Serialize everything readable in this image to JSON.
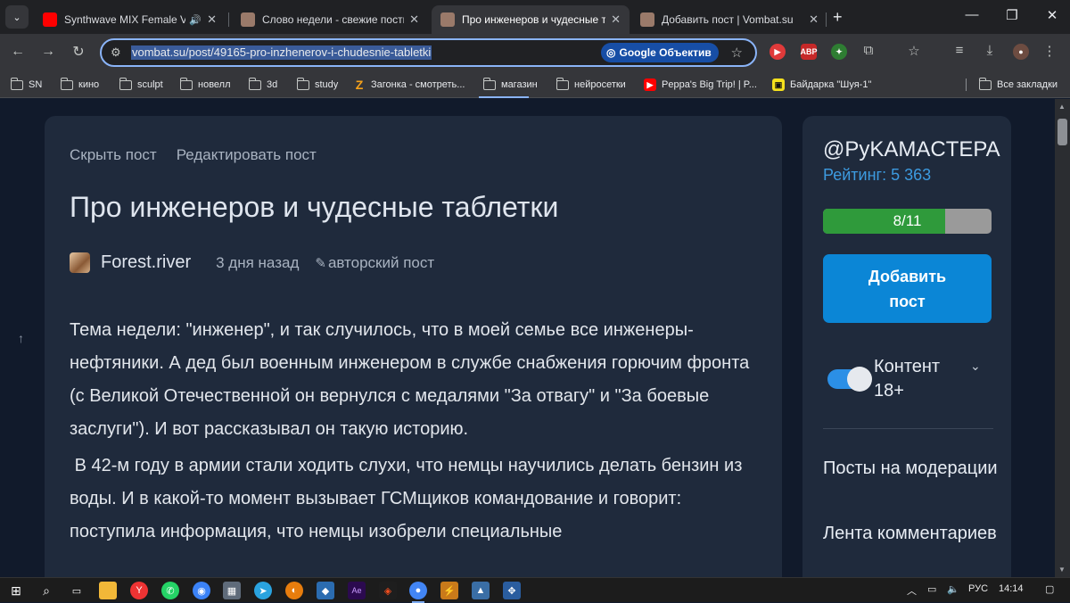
{
  "browser": {
    "tabs": [
      {
        "title": "Synthwave MIX Female Voc",
        "favicon_color": "#ff0000",
        "active": false,
        "has_audio": true
      },
      {
        "title": "Слово недели - свежие посты",
        "favicon_color": "#9a7a6a",
        "active": false,
        "has_audio": false
      },
      {
        "title": "Про инженеров и чудесные та",
        "favicon_color": "#9a7a6a",
        "active": true,
        "has_audio": false
      },
      {
        "title": "Добавить пост | Vombat.su",
        "favicon_color": "#9a7a6a",
        "active": false,
        "has_audio": false
      }
    ],
    "url": "vombat.su/post/49165-pro-inzhenerov-i-chudesnie-tabletki",
    "lens_label": "Google Объектив",
    "bookmarks": [
      {
        "label": "SN",
        "icon": "folder-icon"
      },
      {
        "label": "кино",
        "icon": "folder-icon"
      },
      {
        "label": "sculpt",
        "icon": "folder-icon"
      },
      {
        "label": "новелл",
        "icon": "folder-icon"
      },
      {
        "label": "3d",
        "icon": "folder-icon"
      },
      {
        "label": "study",
        "icon": "folder-icon"
      },
      {
        "label": "Загонка - смотреть...",
        "icon": "zagonka-icon"
      },
      {
        "label": "магазин",
        "icon": "folder-icon"
      },
      {
        "label": "нейросетки",
        "icon": "folder-icon"
      },
      {
        "label": "Peppa's Big Trip! | P...",
        "icon": "youtube-icon"
      },
      {
        "label": "Байдарка \"Шуя-1\"",
        "icon": "market-icon"
      }
    ],
    "all_bookmarks_label": "Все закладки"
  },
  "post": {
    "actions": [
      "Скрыть пост",
      "Редактировать пост"
    ],
    "title": "Про инженеров и чудесные таблетки",
    "author": "Forest.river",
    "time_ago": "3 дня назад",
    "tag": "авторский пост",
    "paragraphs": [
      "Тема недели: \"инженер\", и так случилось, что в моей семье все инженеры- нефтяники. А дед был военным инженером в службе снабжения горючим фронта (с Великой Отечественной он вернулся с медалями \"За отвагу\" и \"За боевые заслуги\"). И вот рассказывал он такую историю.",
      " В 42-м году в армии стали ходить слухи, что немцы научились делать бензин из воды. И в какой-то момент вызывает ГСМщиков командование и говорит: поступила информация, что немцы изобрели специальные"
    ]
  },
  "sidebar": {
    "handle": "@PyKAMACTEPA",
    "rating_label": "Рейтинг: 5 363",
    "progress_text": "8/11",
    "progress_fraction": 0.7273,
    "add_post_line1": "Добавить",
    "add_post_line2": "пост",
    "content_toggle_label": "Контент 18+",
    "content_toggle_on": true,
    "links": [
      "Посты на модерации",
      "Лента комментариев"
    ]
  },
  "taskbar": {
    "lang": "РУС",
    "time": "14:14"
  },
  "colors": {
    "page_bg": "#111a2b",
    "card_bg": "#1f2a3c",
    "accent_blue": "#0b86d6",
    "rating_blue": "#3d9be0",
    "progress_green": "#2f9a3b"
  }
}
